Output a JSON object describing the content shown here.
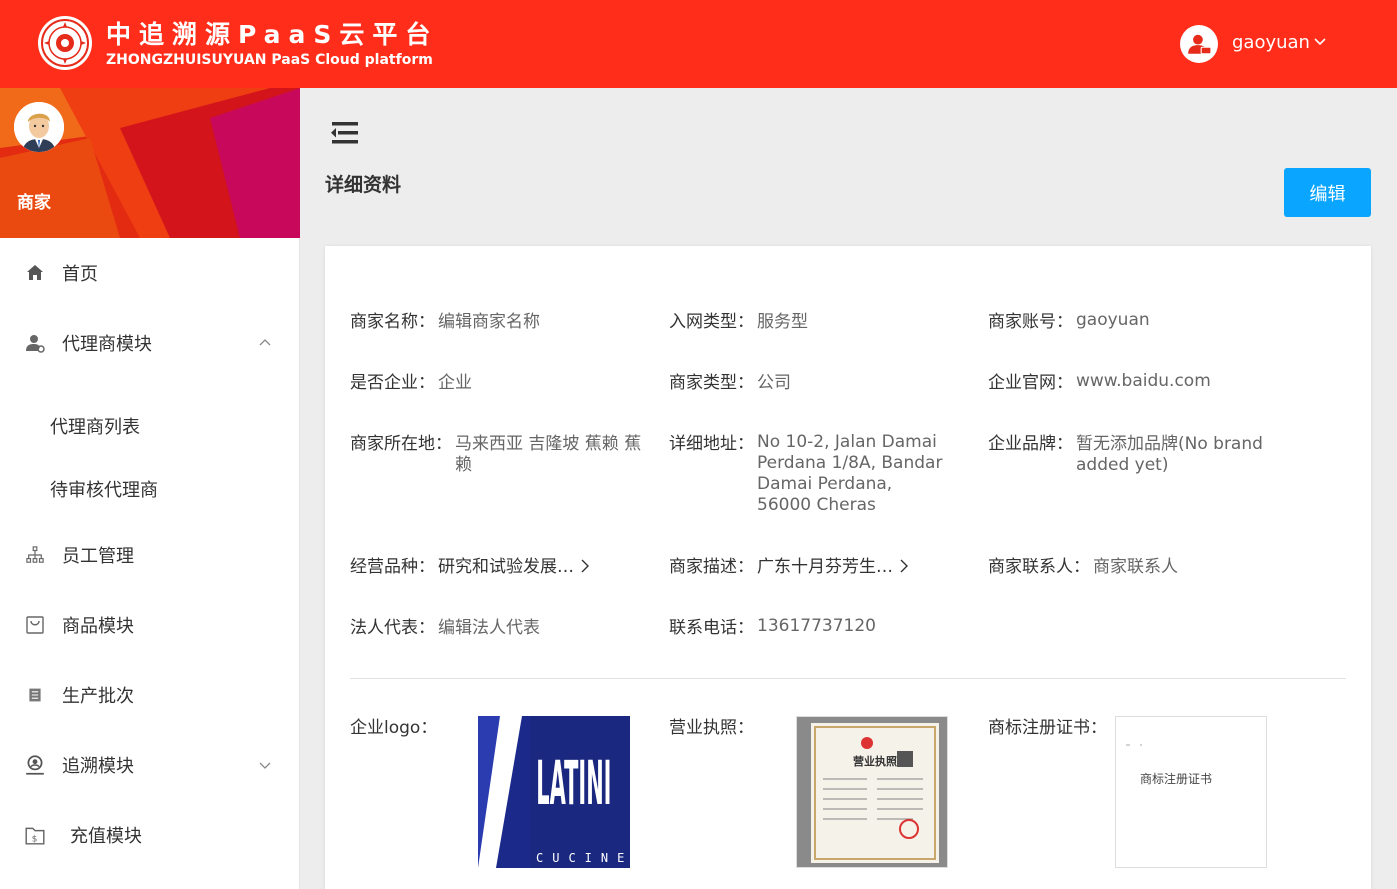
{
  "header": {
    "brand_cn": "中追溯源PaaS云平台",
    "brand_en": "ZHONGZHUISUYUAN PaaS Cloud platform",
    "username": "gaoyuan",
    "bg_color": "#ff2d1a"
  },
  "sidebar": {
    "role": "商家",
    "items": [
      {
        "label": "首页",
        "icon": "home-icon"
      },
      {
        "label": "代理商模块",
        "icon": "agent-icon",
        "expanded": true
      },
      {
        "label": "代理商列表"
      },
      {
        "label": "待审核代理商"
      },
      {
        "label": "员工管理",
        "icon": "org-icon"
      },
      {
        "label": "商品模块",
        "icon": "bag-icon"
      },
      {
        "label": "生产批次",
        "icon": "list-icon"
      },
      {
        "label": "追溯模块",
        "icon": "location-user-icon",
        "expanded": false
      },
      {
        "label": "充值模块",
        "icon": "wallet-icon"
      }
    ]
  },
  "main": {
    "title": "详细资料",
    "edit_label": "编辑",
    "accent_color": "#0aa5ff"
  },
  "details": {
    "merchant_name": {
      "label": "商家名称：",
      "value": "编辑商家名称"
    },
    "network_type": {
      "label": "入网类型：",
      "value": "服务型"
    },
    "account": {
      "label": "商家账号：",
      "value": "gaoyuan"
    },
    "is_enterprise": {
      "label": "是否企业：",
      "value": "企业"
    },
    "merchant_type": {
      "label": "商家类型：",
      "value": "公司"
    },
    "website": {
      "label": "企业官网：",
      "value": "www.baidu.com"
    },
    "location": {
      "label": "商家所在地：",
      "value": "马来西亚 吉隆坡 蕉赖 蕉赖"
    },
    "address": {
      "label": "详细地址：",
      "value": "No 10-2, Jalan Damai Perdana 1/8A, Bandar Damai Perdana, 56000 Cheras"
    },
    "brand": {
      "label": "企业品牌：",
      "value": "暂无添加品牌(No brand added yet)"
    },
    "category": {
      "label": "经营品种：",
      "value": "研究和试验发展…"
    },
    "description": {
      "label": "商家描述：",
      "value": "广东十月芬芳生…"
    },
    "contact": {
      "label": "商家联系人：",
      "value": "商家联系人"
    },
    "legal_rep": {
      "label": "法人代表：",
      "value": "编辑法人代表"
    },
    "phone": {
      "label": "联系电话：",
      "value": "13617737120"
    }
  },
  "images": {
    "logo": {
      "label": "企业logo：",
      "text_main": "LATINI",
      "text_sub": "CUCINE"
    },
    "license": {
      "label": "营业执照：",
      "text": "营业执照"
    },
    "trademark": {
      "label": "商标注册证书：",
      "text": "商标注册证书"
    }
  }
}
